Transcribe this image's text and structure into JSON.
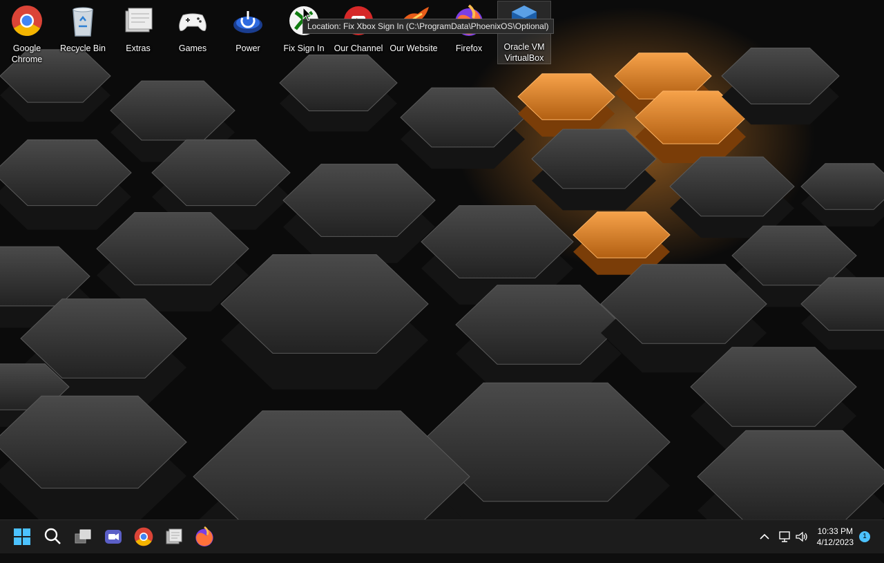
{
  "desktop": {
    "icons": [
      {
        "label": "Google Chrome",
        "icon": "chrome-icon"
      },
      {
        "label": "Recycle Bin",
        "icon": "recycle-bin-icon"
      },
      {
        "label": "Extras",
        "icon": "folder-icon"
      },
      {
        "label": "Games",
        "icon": "gamepad-icon"
      },
      {
        "label": "Power",
        "icon": "power-icon"
      },
      {
        "label": "Fix Sign In",
        "icon": "xbox-icon"
      },
      {
        "label": "Our Channel",
        "icon": "youtube-icon"
      },
      {
        "label": "Our Website",
        "icon": "phoenix-icon"
      },
      {
        "label": "Firefox",
        "icon": "firefox-icon"
      },
      {
        "label": "Oracle VM VirtualBox",
        "icon": "virtualbox-icon"
      }
    ],
    "tooltip": "Location: Fix Xbox Sign In (C:\\ProgramData\\PhoenixOS\\Optional)"
  },
  "taskbar": {
    "apps": [
      {
        "name": "start",
        "icon": "windows-start-icon"
      },
      {
        "name": "search",
        "icon": "search-icon"
      },
      {
        "name": "task-view",
        "icon": "task-view-icon"
      },
      {
        "name": "teams-chat",
        "icon": "teams-chat-icon"
      },
      {
        "name": "chrome",
        "icon": "chrome-icon"
      },
      {
        "name": "file-explorer",
        "icon": "file-explorer-icon"
      },
      {
        "name": "firefox",
        "icon": "firefox-icon"
      }
    ],
    "tray": {
      "time": "10:33 PM",
      "date": "4/12/2023",
      "notification_count": "1"
    }
  },
  "colors": {
    "taskbar_bg": "#1c1c1c",
    "accent_orange": "#e88a2a",
    "hex_dark": "#2a2a2a",
    "badge": "#4cc2ff"
  }
}
